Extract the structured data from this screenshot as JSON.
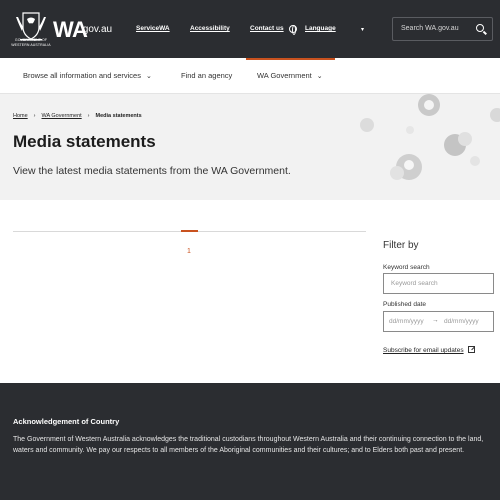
{
  "header": {
    "crest_caption": "GOVERNMENT OF WESTERN AUSTRALIA",
    "logo_main": "WA",
    "logo_suffix": ".gov.au",
    "links": [
      "ServiceWA",
      "Accessibility",
      "Contact us",
      "Language"
    ],
    "search_placeholder": "Search WA.gov.au"
  },
  "nav": {
    "items": [
      "Browse all information and services",
      "Find an agency",
      "WA Government"
    ]
  },
  "breadcrumb": {
    "home": "Home",
    "parent": "WA Government",
    "current": "Media statements"
  },
  "hero": {
    "title": "Media statements",
    "subtitle": "View the latest media statements from the WA Government."
  },
  "results": {
    "page": "1"
  },
  "filter": {
    "title": "Filter by",
    "keyword_label": "Keyword search",
    "keyword_placeholder": "Keyword search",
    "date_label": "Published date",
    "date_from": "dd/mm/yyyy",
    "date_to": "dd/mm/yyyy",
    "subscribe": "Subscribe for email updates"
  },
  "footer": {
    "ack_title": "Acknowledgement of Country",
    "ack_text": "The Government of Western Australia acknowledges the traditional custodians throughout Western Australia and their continuing connection to the land, waters and community. We pay our respects to all members of the Aboriginal communities and their cultures; and to Elders both past and present."
  },
  "colors": {
    "header_bg": "#2b2d31",
    "accent": "#c9521f",
    "hero_bg": "#f2f2f2"
  }
}
